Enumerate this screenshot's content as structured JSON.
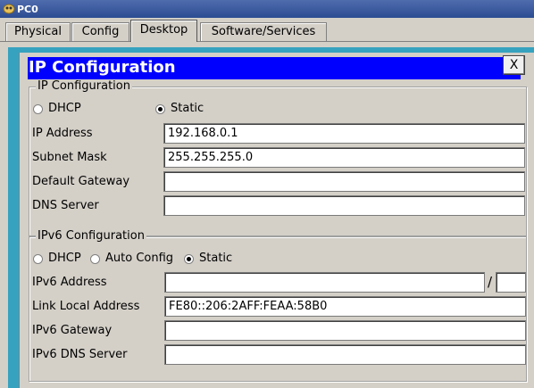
{
  "window": {
    "title": "PC0"
  },
  "tabs": [
    {
      "label": "Physical",
      "active": false
    },
    {
      "label": "Config",
      "active": false
    },
    {
      "label": "Desktop",
      "active": true
    },
    {
      "label": "Software/Services",
      "active": false
    }
  ],
  "ip_config": {
    "header": "IP Configuration",
    "close_label": "X",
    "ipv4": {
      "legend": "IP Configuration",
      "mode_options": [
        "DHCP",
        "Static"
      ],
      "selected_mode": "Static",
      "fields": [
        {
          "label": "IP Address",
          "value": "192.168.0.1"
        },
        {
          "label": "Subnet Mask",
          "value": "255.255.255.0"
        },
        {
          "label": "Default Gateway",
          "value": ""
        },
        {
          "label": "DNS Server",
          "value": ""
        }
      ]
    },
    "ipv6": {
      "legend": "IPv6 Configuration",
      "mode_options": [
        "DHCP",
        "Auto Config",
        "Static"
      ],
      "selected_mode": "Static",
      "address_label": "IPv6 Address",
      "address_value": "",
      "prefix_separator": "/",
      "prefix_value": "",
      "fields": [
        {
          "label": "Link Local Address",
          "value": "FE80::206:2AFF:FEAA:58B0"
        },
        {
          "label": "IPv6 Gateway",
          "value": ""
        },
        {
          "label": "IPv6 DNS Server",
          "value": ""
        }
      ]
    }
  },
  "colors": {
    "header_blue": "#0000ff",
    "accent_cyan": "#37a2bf",
    "chrome_gray": "#d4d0c8"
  },
  "icons": {
    "app": "packet-tracer-pc-icon"
  }
}
